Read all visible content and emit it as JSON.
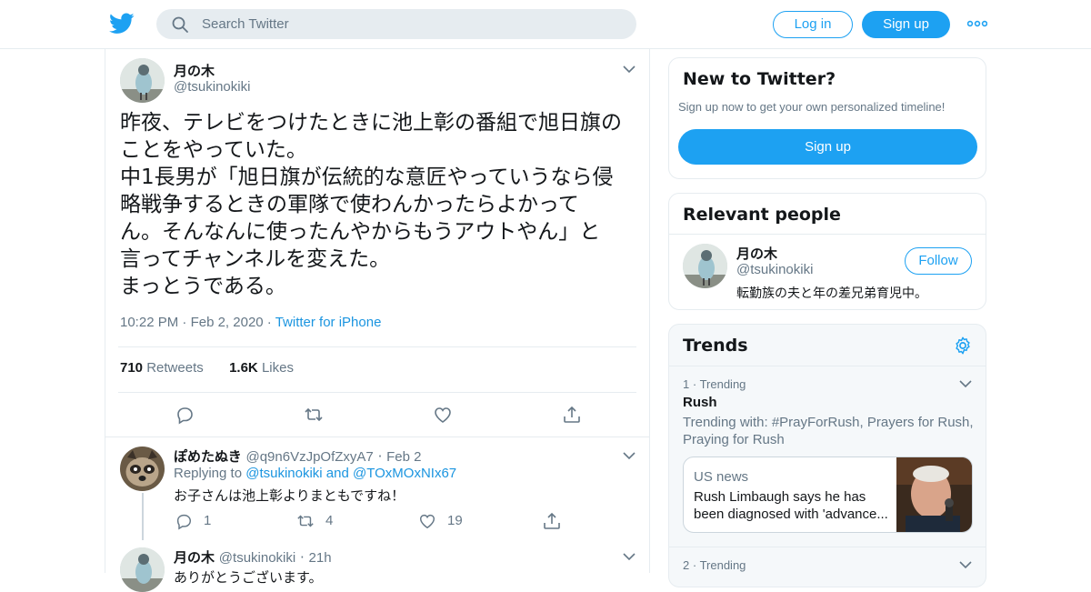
{
  "header": {
    "search_placeholder": "Search Twitter",
    "login_label": "Log in",
    "signup_label": "Sign up",
    "brand_color": "#1da1f2"
  },
  "tweet": {
    "name": "月の木",
    "handle": "@tsukinokiki",
    "text": "昨夜、テレビをつけたときに池上彰の番組で旭日旗の\nことをやっていた。\n中1長男が「旭日旗が伝統的な意匠やっていうなら侵\n略戦争するときの軍隊で使わんかったらよかって\nん。そんなんに使ったんやからもうアウトやん」と\n言ってチャンネルを変えた。\nまっとうである。",
    "time": "10:22 PM",
    "date": "Feb 2, 2020",
    "source": "Twitter for iPhone",
    "retweets_count": "710",
    "retweets_label": "Retweets",
    "likes_count": "1.6K",
    "likes_label": "Likes"
  },
  "replies": [
    {
      "name": "ぽめたぬき",
      "handle": "@q9n6VzJpOfZxyA7",
      "date": "Feb 2",
      "replying_prefix": "Replying to",
      "replying_to": "@tsukinokiki and @TOxMOxNIx67",
      "text": "お子さんは池上彰よりまともですね！",
      "reply_count": "1",
      "retweet_count": "4",
      "like_count": "19"
    },
    {
      "name": "月の木",
      "handle": "@tsukinokiki",
      "date": "21h",
      "text": "ありがとうございます。"
    }
  ],
  "sidebar": {
    "new_to_twitter": {
      "title": "New to Twitter?",
      "subtitle": "Sign up now to get your own personalized timeline!",
      "button": "Sign up"
    },
    "relevant_people": {
      "title": "Relevant people",
      "name": "月の木",
      "handle": "@tsukinokiki",
      "bio": "転勤族の夫と年の差兄弟育児中。",
      "follow_label": "Follow"
    },
    "trends": {
      "title": "Trends",
      "items": [
        {
          "rank": "1",
          "label": "Trending",
          "name": "Rush",
          "with": "Trending with: #PrayForRush, Prayers for Rush, Praying for Rush",
          "news_category": "US news",
          "news_headline": "Rush Limbaugh says he has been diagnosed with 'advance..."
        },
        {
          "rank": "2",
          "label": "Trending"
        }
      ]
    }
  }
}
